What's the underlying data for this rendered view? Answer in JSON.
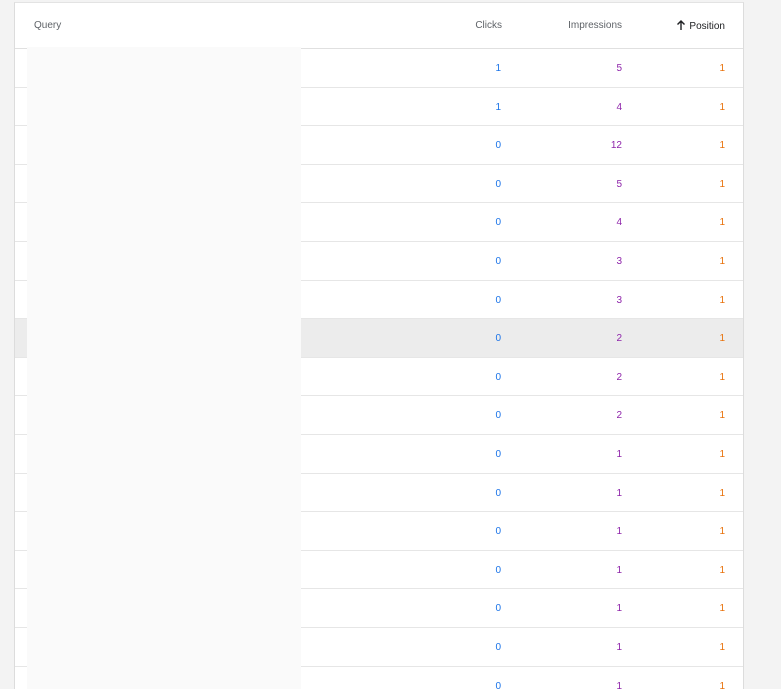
{
  "table": {
    "headers": {
      "query": "Query",
      "clicks": "Clicks",
      "impressions": "Impressions",
      "position": "Position"
    },
    "sort_icon": "arrow-up-icon",
    "highlighted_row": 7,
    "rows": [
      {
        "clicks": "1",
        "impressions": "5",
        "position": "1"
      },
      {
        "clicks": "1",
        "impressions": "4",
        "position": "1"
      },
      {
        "clicks": "0",
        "impressions": "12",
        "position": "1"
      },
      {
        "clicks": "0",
        "impressions": "5",
        "position": "1"
      },
      {
        "clicks": "0",
        "impressions": "4",
        "position": "1"
      },
      {
        "clicks": "0",
        "impressions": "3",
        "position": "1"
      },
      {
        "clicks": "0",
        "impressions": "3",
        "position": "1"
      },
      {
        "clicks": "0",
        "impressions": "2",
        "position": "1"
      },
      {
        "clicks": "0",
        "impressions": "2",
        "position": "1"
      },
      {
        "clicks": "0",
        "impressions": "2",
        "position": "1"
      },
      {
        "clicks": "0",
        "impressions": "1",
        "position": "1"
      },
      {
        "clicks": "0",
        "impressions": "1",
        "position": "1"
      },
      {
        "clicks": "0",
        "impressions": "1",
        "position": "1"
      },
      {
        "clicks": "0",
        "impressions": "1",
        "position": "1"
      },
      {
        "clicks": "0",
        "impressions": "1",
        "position": "1"
      },
      {
        "clicks": "0",
        "impressions": "1",
        "position": "1"
      },
      {
        "clicks": "0",
        "impressions": "1",
        "position": "1"
      }
    ]
  },
  "colors": {
    "clicks": "#1a73e8",
    "impressions": "#8e24aa",
    "position": "#e8710a"
  }
}
